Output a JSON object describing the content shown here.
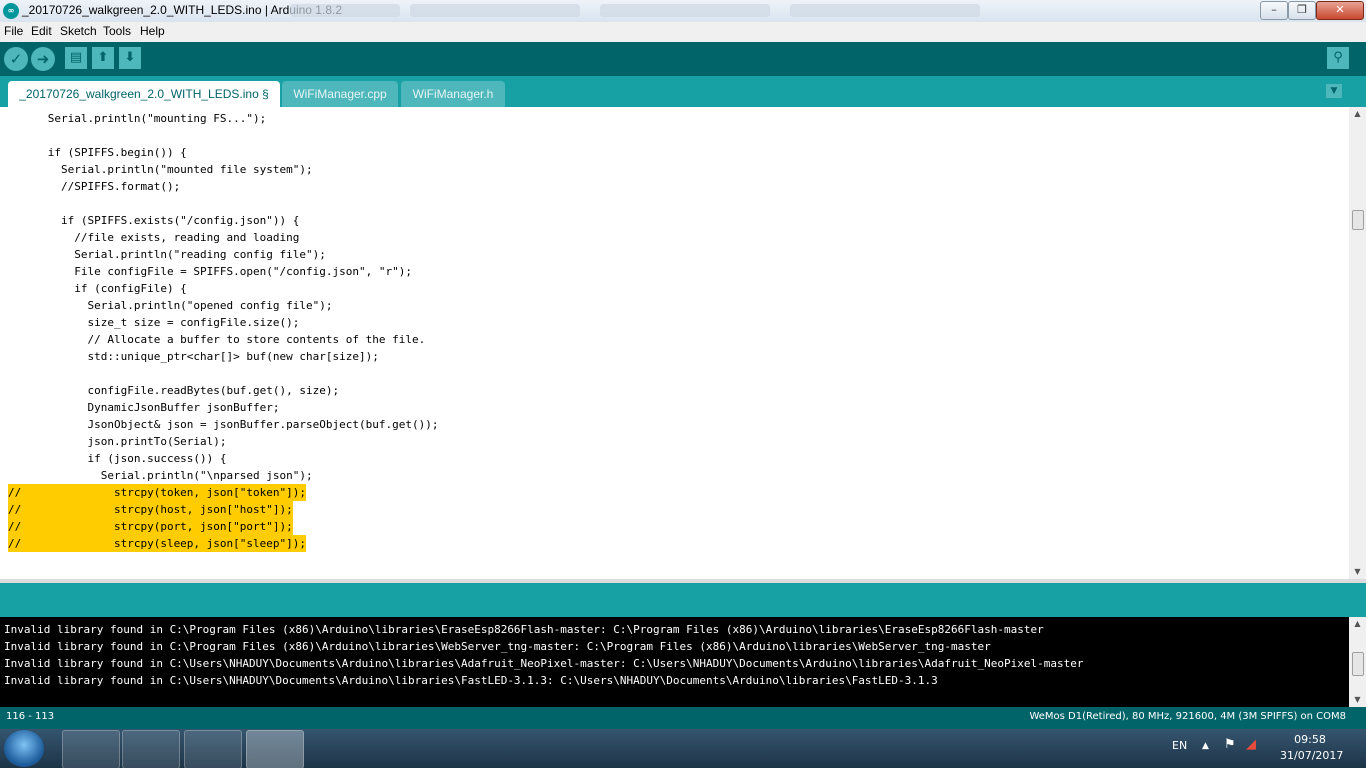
{
  "window": {
    "title": "_20170726_walkgreen_2.0_WITH_LEDS.ino | Arduino 1.8.2",
    "minimize_glyph": "–",
    "maximize_glyph": "❐",
    "close_glyph": "✕"
  },
  "menu": {
    "items": [
      "File",
      "Edit",
      "Sketch",
      "Tools",
      "Help"
    ]
  },
  "toolbar": {
    "verify_icon": "check-icon",
    "upload_icon": "arrow-right-icon",
    "new_icon": "document-icon",
    "open_icon": "arrow-up-icon",
    "save_icon": "arrow-down-icon",
    "serial_monitor_icon": "magnifier-icon"
  },
  "tabs": [
    {
      "label": "_20170726_walkgreen_2.0_WITH_LEDS.ino §",
      "active": true
    },
    {
      "label": "WiFiManager.cpp",
      "active": false
    },
    {
      "label": "WiFiManager.h",
      "active": false
    }
  ],
  "editor": {
    "lines": [
      "      Serial.println(\"mounting FS...\");",
      "",
      "      if (SPIFFS.begin()) {",
      "        Serial.println(\"mounted file system\");",
      "        //SPIFFS.format();",
      "",
      "        if (SPIFFS.exists(\"/config.json\")) {",
      "          //file exists, reading and loading",
      "          Serial.println(\"reading config file\");",
      "          File configFile = SPIFFS.open(\"/config.json\", \"r\");",
      "          if (configFile) {",
      "            Serial.println(\"opened config file\");",
      "            size_t size = configFile.size();",
      "            // Allocate a buffer to store contents of the file.",
      "            std::unique_ptr<char[]> buf(new char[size]);",
      "",
      "            configFile.readBytes(buf.get(), size);",
      "            DynamicJsonBuffer jsonBuffer;",
      "            JsonObject& json = jsonBuffer.parseObject(buf.get());",
      "            json.printTo(Serial);",
      "            if (json.success()) {",
      "              Serial.println(\"\\nparsed json\");",
      "//              strcpy(token, json[\"token\"]);",
      "//              strcpy(host, json[\"host\"]);",
      "//              strcpy(port, json[\"port\"]);",
      "//              strcpy(sleep, json[\"sleep\"]);"
    ],
    "highlighted_from_line": 22
  },
  "console": {
    "lines": [
      "Invalid library found in C:\\Program Files (x86)\\Arduino\\libraries\\EraseEsp8266Flash-master: C:\\Program Files (x86)\\Arduino\\libraries\\EraseEsp8266Flash-master",
      "Invalid library found in C:\\Program Files (x86)\\Arduino\\libraries\\WebServer_tng-master: C:\\Program Files (x86)\\Arduino\\libraries\\WebServer_tng-master",
      "Invalid library found in C:\\Users\\NHADUY\\Documents\\Arduino\\libraries\\Adafruit_NeoPixel-master: C:\\Users\\NHADUY\\Documents\\Arduino\\libraries\\Adafruit_NeoPixel-master",
      "Invalid library found in C:\\Users\\NHADUY\\Documents\\Arduino\\libraries\\FastLED-3.1.3: C:\\Users\\NHADUY\\Documents\\Arduino\\libraries\\FastLED-3.1.3"
    ]
  },
  "status": {
    "position": "116 - 113",
    "board": "WeMos D1(Retired), 80 MHz, 921600, 4M (3M SPIFFS) on COM8"
  },
  "taskbar": {
    "language": "EN",
    "time": "09:58",
    "date": "31/07/2017",
    "items": [
      "explorer-icon",
      "sticky-notes-icon",
      "chrome-icon",
      "arduino-icon"
    ]
  },
  "colors": {
    "toolbar": "#006468",
    "tabbar": "#17a1a5",
    "accent": "#4db7bb",
    "highlight": "#ffcc00",
    "keyword": "#cc6600",
    "comment": "#95a5a6",
    "string": "#005c5f"
  }
}
